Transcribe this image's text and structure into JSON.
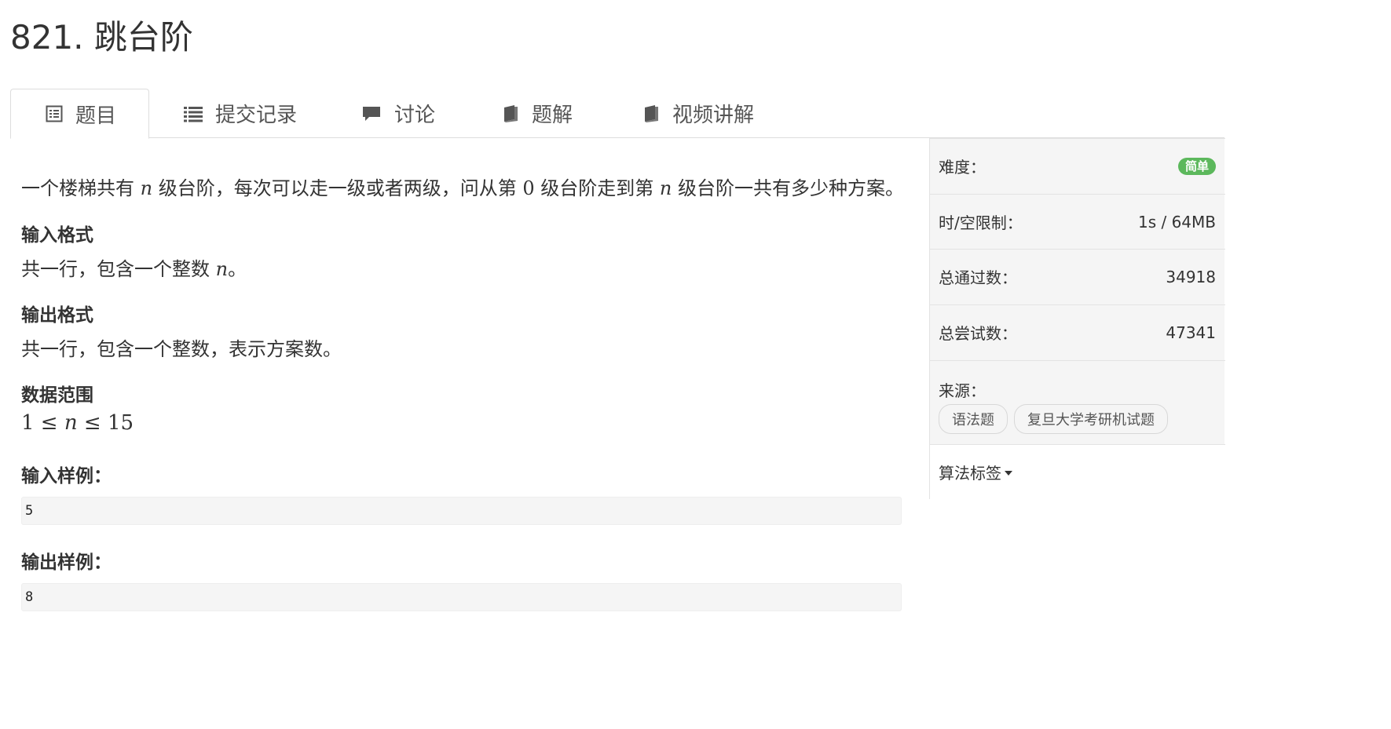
{
  "problem": {
    "title": "821. 跳台阶"
  },
  "tabs": [
    {
      "label": "题目",
      "icon": "document-list-icon"
    },
    {
      "label": "提交记录",
      "icon": "list-icon"
    },
    {
      "label": "讨论",
      "icon": "comment-icon"
    },
    {
      "label": "题解",
      "icon": "book-icon"
    },
    {
      "label": "视频讲解",
      "icon": "book-icon"
    }
  ],
  "content": {
    "desc_1": "一个楼梯共有 ",
    "var_n": "n",
    "desc_2": " 级台阶，每次可以走一级或者两级，问从第 ",
    "zero": "0",
    "desc_3": " 级台阶走到第 ",
    "desc_4": " 级台阶一共有多少种方案。",
    "input_format_heading": "输入格式",
    "input_format_1": "共一行，包含一个整数 ",
    "input_format_2": "。",
    "output_format_heading": "输出格式",
    "output_format_text": "共一行，包含一个整数，表示方案数。",
    "range_heading": "数据范围",
    "range_lo": "1",
    "range_leq": " ≤ ",
    "range_hi": "15",
    "sample_input_heading": "输入样例：",
    "sample_input": "5",
    "sample_output_heading": "输出样例：",
    "sample_output": "8"
  },
  "sidebar": {
    "difficulty_label": "难度：",
    "difficulty_value": "简单",
    "limit_label": "时/空限制：",
    "limit_value": "1s / 64MB",
    "passed_label": "总通过数：",
    "passed_value": "34918",
    "attempts_label": "总尝试数：",
    "attempts_value": "47341",
    "source_label": "来源：",
    "source_tags": [
      "语法题",
      "复旦大学考研机试题"
    ],
    "algo_tags_label": "算法标签"
  },
  "colors": {
    "badge_green": "#5cb85c",
    "sidebar_bg": "#f5f5f5"
  }
}
